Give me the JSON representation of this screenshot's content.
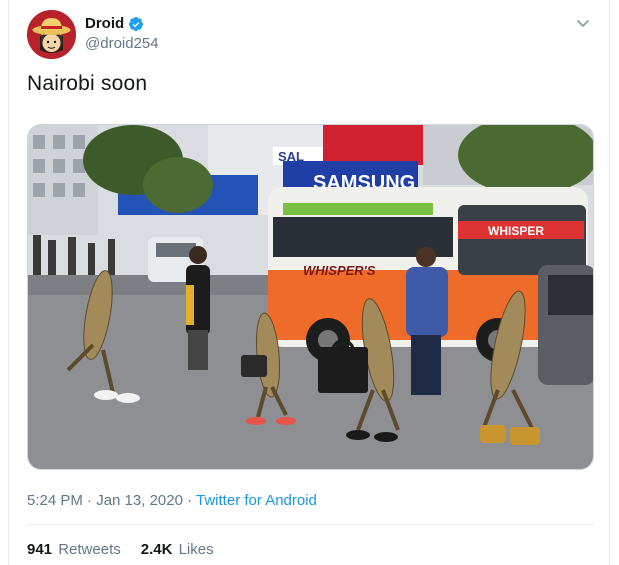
{
  "tweet": {
    "author": {
      "name": "Droid",
      "handle": "@droid254",
      "verified": true,
      "avatar_icon": "straw-hat-avatar-icon"
    },
    "text": "Nairobi soon",
    "media": {
      "sign_samsung": "SAMSUNG",
      "sign_sal": "SAL",
      "bus_sign": "WHISPER",
      "bus_side": "WHISPER'S"
    },
    "timestamp": "5:24 PM · Jan 13, 2020",
    "separator": "·",
    "source": "Twitter for Android",
    "retweets_count": "941",
    "retweets_label": "Retweets",
    "likes_count": "2.4K",
    "likes_label": "Likes"
  },
  "colors": {
    "accent": "#1b95e0",
    "verified": "#1da1f2",
    "secondary_text": "#657786",
    "border": "#e6ecf0"
  }
}
